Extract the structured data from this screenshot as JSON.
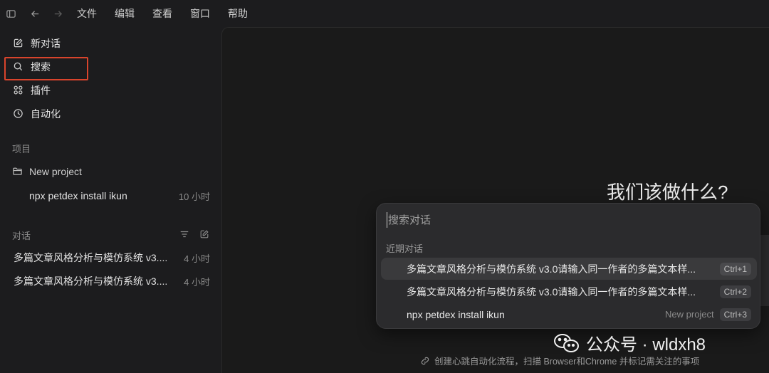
{
  "menu": [
    "文件",
    "编辑",
    "查看",
    "窗口",
    "帮助"
  ],
  "nav": [
    {
      "label": "新对话",
      "icon": "edit-icon"
    },
    {
      "label": "搜索",
      "icon": "search-icon"
    },
    {
      "label": "插件",
      "icon": "plugins-icon"
    },
    {
      "label": "自动化",
      "icon": "clock-icon"
    }
  ],
  "projects": {
    "section_label": "项目",
    "folder": "New project",
    "items": [
      {
        "title": "npx petdex install ikun",
        "time": "10 小时"
      }
    ]
  },
  "conversations": {
    "section_label": "对话",
    "items": [
      {
        "title": "多篇文章风格分析与模仿系统 v3....",
        "time": "4 小时"
      },
      {
        "title": "多篇文章风格分析与模仿系统 v3....",
        "time": "4 小时"
      }
    ]
  },
  "main": {
    "headline": "我们该做什么?",
    "footer_hint": "创建心跳自动化流程，扫描 Browser和Chrome 并标记需关注的事项"
  },
  "palette": {
    "placeholder": "搜索对话",
    "section_label": "近期对话",
    "items": [
      {
        "title": "多篇文章风格分析与模仿系统 v3.0请输入同一作者的多篇文本样...",
        "project": "",
        "shortcut": "Ctrl+1"
      },
      {
        "title": "多篇文章风格分析与模仿系统 v3.0请输入同一作者的多篇文本样...",
        "project": "",
        "shortcut": "Ctrl+2"
      },
      {
        "title": "npx petdex install ikun",
        "project": "New project",
        "shortcut": "Ctrl+3"
      }
    ]
  },
  "watermark": "公众号 · wldxh8"
}
